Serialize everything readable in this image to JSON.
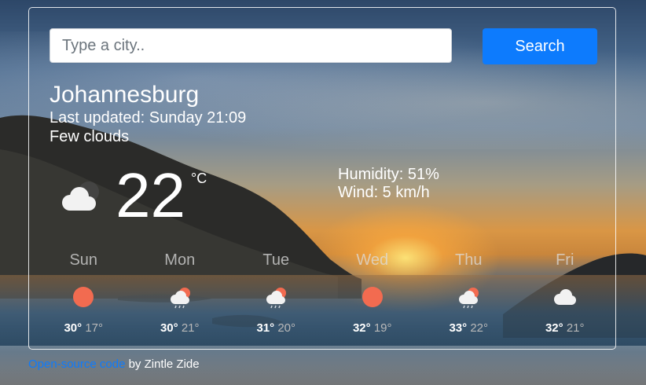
{
  "search": {
    "placeholder": "Type a city..",
    "value": "",
    "button_label": "Search"
  },
  "current": {
    "city": "Johannesburg",
    "last_updated": "Last updated: Sunday 21:09",
    "condition": "Few clouds",
    "temperature": "22",
    "unit": "°C",
    "humidity": "Humidity: 51%",
    "wind": "Wind: 5 km/h",
    "icon": "few-clouds-night-icon"
  },
  "forecast": [
    {
      "day": "Sun",
      "max": "30°",
      "min": "17°",
      "icon": "sun-icon"
    },
    {
      "day": "Mon",
      "max": "30°",
      "min": "21°",
      "icon": "sun-rain-icon"
    },
    {
      "day": "Tue",
      "max": "31°",
      "min": "20°",
      "icon": "sun-rain-icon"
    },
    {
      "day": "Wed",
      "max": "32°",
      "min": "19°",
      "icon": "sun-icon"
    },
    {
      "day": "Thu",
      "max": "33°",
      "min": "22°",
      "icon": "sun-rain-icon"
    },
    {
      "day": "Fri",
      "max": "32°",
      "min": "21°",
      "icon": "cloud-icon"
    }
  ],
  "footer": {
    "link_text": "Open-source code",
    "suffix": " by Zintle Zide"
  },
  "colors": {
    "accent": "#0d7bfd",
    "sun": "#f26b50"
  }
}
